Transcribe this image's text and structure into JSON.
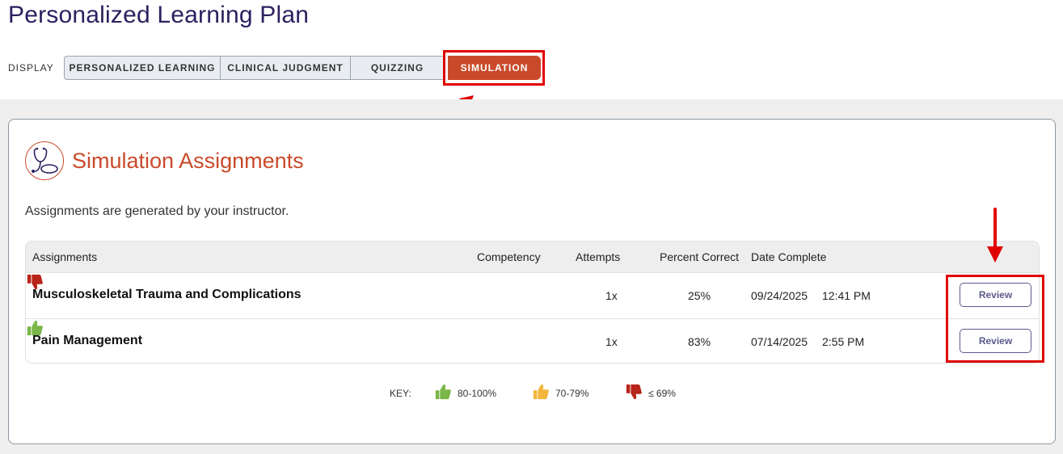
{
  "page": {
    "title": "Personalized Learning Plan"
  },
  "display": {
    "label": "DISPLAY",
    "tabs": [
      {
        "label": "PERSONALIZED LEARNING",
        "active": false
      },
      {
        "label": "CLINICAL JUDGMENT",
        "active": false
      },
      {
        "label": "QUIZZING",
        "active": false
      },
      {
        "label": "SIMULATION",
        "active": true
      }
    ]
  },
  "section": {
    "icon": "stethoscope-icon",
    "title": "Simulation Assignments",
    "description": "Assignments are generated by your instructor."
  },
  "table": {
    "headers": {
      "assignments": "Assignments",
      "competency": "Competency",
      "attempts": "Attempts",
      "percent": "Percent Correct",
      "date": "Date Complete"
    },
    "rows": [
      {
        "name": "Musculoskeletal Trauma and Complications",
        "competency": "thumbs-down-icon",
        "attempts": "1x",
        "percent": "25%",
        "date": "09/24/2025",
        "time": "12:41 PM",
        "action": "Review"
      },
      {
        "name": "Pain Management",
        "competency": "thumbs-up-icon",
        "attempts": "1x",
        "percent": "83%",
        "date": "07/14/2025",
        "time": "2:55 PM",
        "action": "Review"
      }
    ]
  },
  "key": {
    "label": "KEY:",
    "items": [
      {
        "icon": "thumbs-up-icon",
        "color": "#7ab648",
        "text": "80-100%"
      },
      {
        "icon": "thumbs-up-icon",
        "color": "#f2b63c",
        "text": "70-79%"
      },
      {
        "icon": "thumbs-down-icon",
        "color": "#b8251a",
        "text": "≤ 69%"
      }
    ]
  },
  "colors": {
    "brand": "#c94a2a",
    "title": "#2e2060",
    "highlight": "#e00000",
    "good": "#7ab648",
    "fair": "#f2b63c",
    "poor": "#b8251a"
  }
}
